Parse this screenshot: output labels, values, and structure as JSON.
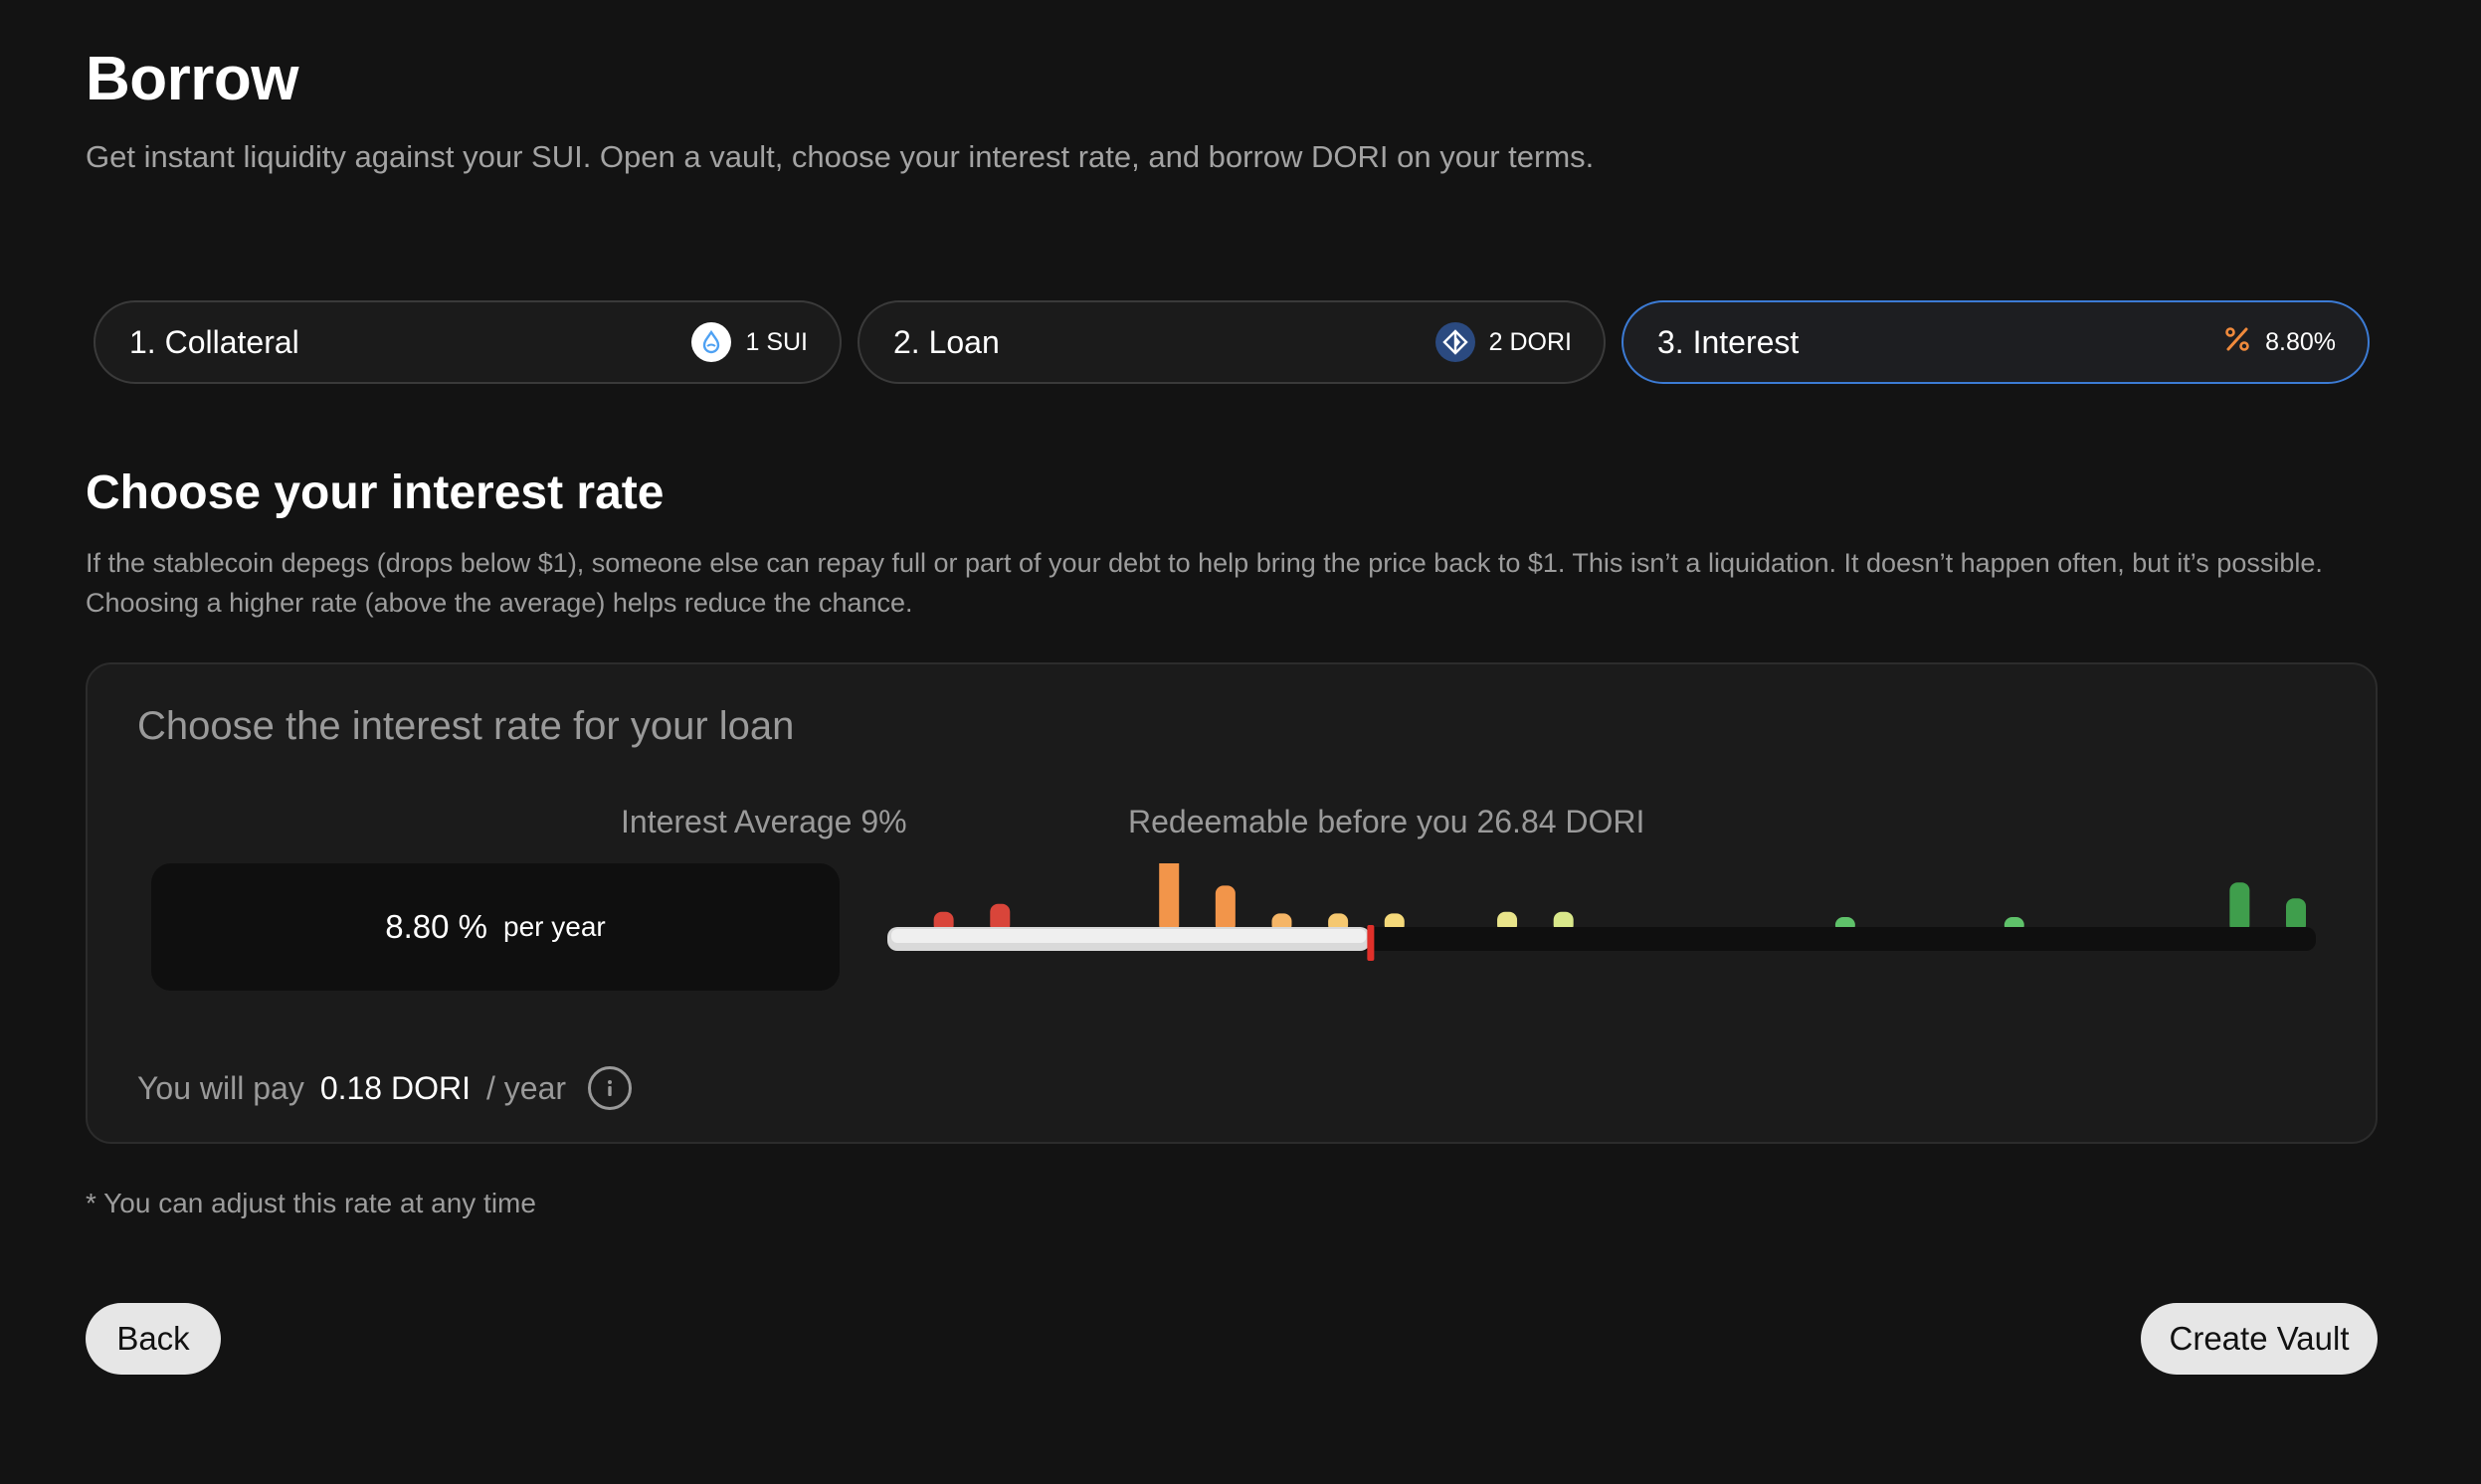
{
  "header": {
    "title": "Borrow",
    "subtitle": "Get instant liquidity against your SUI. Open a vault, choose your interest rate, and borrow DORI on your terms."
  },
  "steps": [
    {
      "label": "1. Collateral",
      "value": "1 SUI",
      "icon": "sui-coin-icon"
    },
    {
      "label": "2. Loan",
      "value": "2 DORI",
      "icon": "dori-coin-icon"
    },
    {
      "label": "3. Interest",
      "value": "8.80%",
      "icon": "percent-icon",
      "active": true
    }
  ],
  "section": {
    "title": "Choose your interest rate",
    "description": "If the stablecoin depegs (drops below $1), someone else can repay full or part of your debt to help bring the price back to $1. This isn’t a liquidation. It doesn’t happen often, but it’s possible. Choosing a higher rate (above the average) helps reduce the chance."
  },
  "card": {
    "title": "Choose the interest rate for your loan",
    "average_label": "Interest Average 9%",
    "redeemable_label": "Redeemable before you 26.84 DORI",
    "rate_value": "8.80 %",
    "rate_unit": "per year",
    "pay_prefix": "You will pay",
    "pay_amount": "0.18 DORI",
    "pay_suffix": "/ year"
  },
  "slider": {
    "position_fraction": 0.338,
    "track_color": "#0f0f0f",
    "fill_color": "#d9d9d9",
    "handle_color": "#e0302a"
  },
  "chart_data": {
    "type": "bar",
    "description_values": "relative debt distribution per interest rate bucket",
    "values": [
      0.19,
      0.29,
      1.0,
      0.52,
      0.17,
      0.17,
      0.17,
      0.19,
      0.19,
      0.12,
      0.1,
      0.56,
      0.36
    ],
    "positions": [
      0.04,
      0.08,
      0.2,
      0.24,
      0.28,
      0.32,
      0.36,
      0.44,
      0.48,
      0.68,
      0.8,
      0.96,
      1.0
    ],
    "colors": [
      "#d9453a",
      "#d9453a",
      "#f2954a",
      "#f2954a",
      "#f5b566",
      "#f5c870",
      "#f5d97a",
      "#e9e48a",
      "#d9e88a",
      "#5fc26a",
      "#5fc26a",
      "#3f9e4c",
      "#3f9e4c"
    ]
  },
  "footnote": "* You can adjust this rate at any time",
  "buttons": {
    "back": "Back",
    "create": "Create Vault"
  }
}
